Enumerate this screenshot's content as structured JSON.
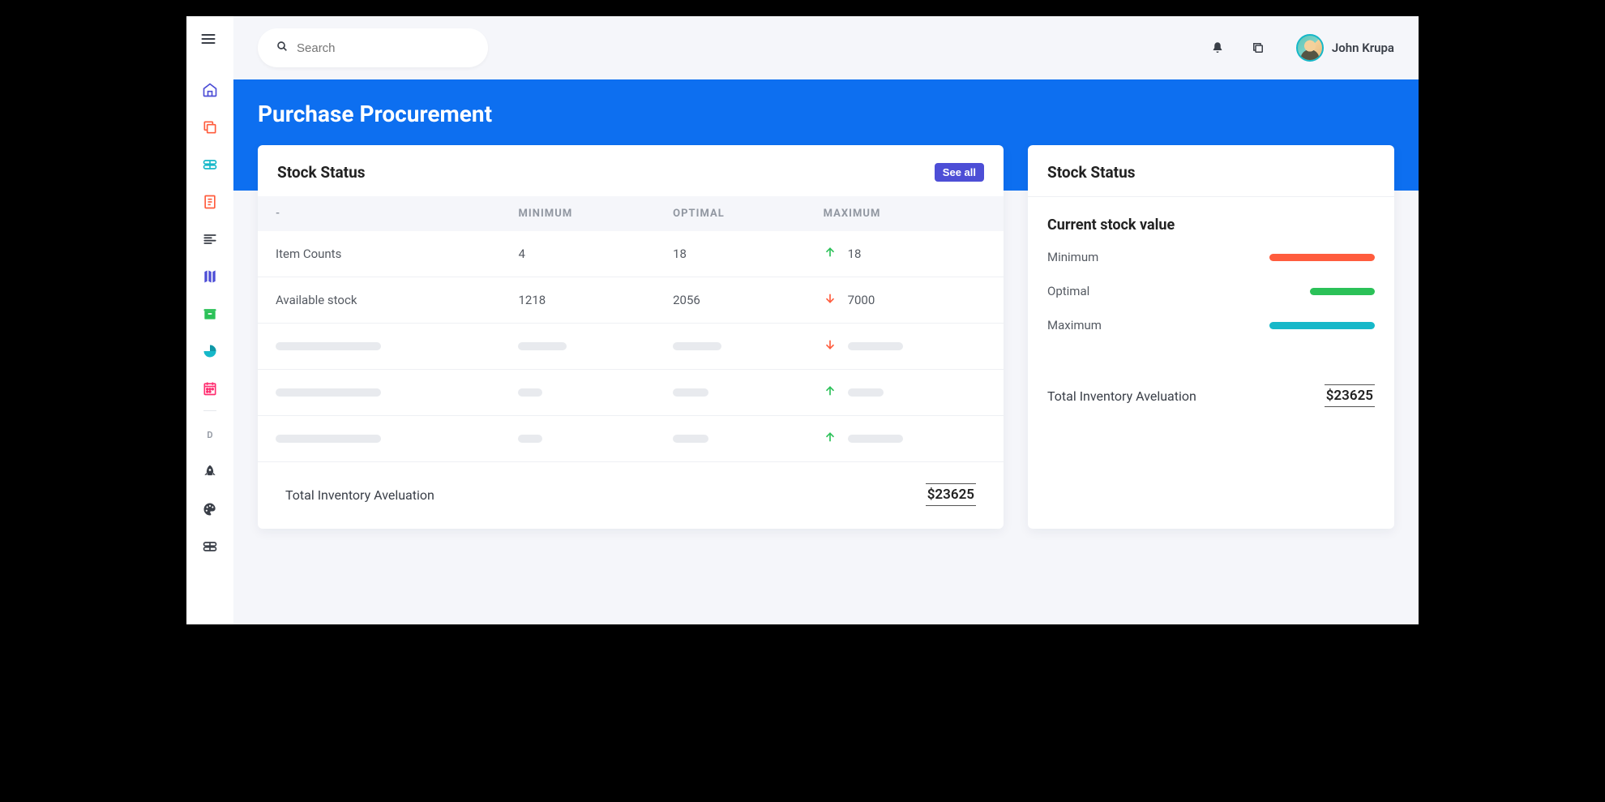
{
  "search": {
    "placeholder": "Search"
  },
  "user": {
    "name": "John Krupa"
  },
  "sidebar": {
    "text_item": "D"
  },
  "page": {
    "title": "Purchase Procurement"
  },
  "stock_card": {
    "title": "Stock Status",
    "see_all": "See all",
    "columns": {
      "c0": "-",
      "c1": "MINIMUM",
      "c2": "OPTIMAL",
      "c3": "MAXIMUM"
    },
    "rows": [
      {
        "label": "Item Counts",
        "min": "4",
        "opt": "18",
        "dir": "up",
        "max": "18"
      },
      {
        "label": "Available stock",
        "min": "1218",
        "opt": "2056",
        "dir": "down",
        "max": "7000"
      }
    ],
    "placeholder_rows": [
      {
        "dir": "down"
      },
      {
        "dir": "up"
      },
      {
        "dir": "up"
      }
    ],
    "footer_label": "Total Inventory Aveluation",
    "footer_value": "$23625"
  },
  "side_card": {
    "title": "Stock Status",
    "section_title": "Current stock value",
    "legend": {
      "min": "Minimum",
      "opt": "Optimal",
      "max": "Maximum"
    },
    "footer_label": "Total Inventory Aveluation",
    "footer_value": "$23625"
  },
  "colors": {
    "primary": "#0d6ff0",
    "accent": "#4d4ed6",
    "up": "#2bc158",
    "down": "#ff5c3d",
    "cyan": "#16b8c9"
  }
}
